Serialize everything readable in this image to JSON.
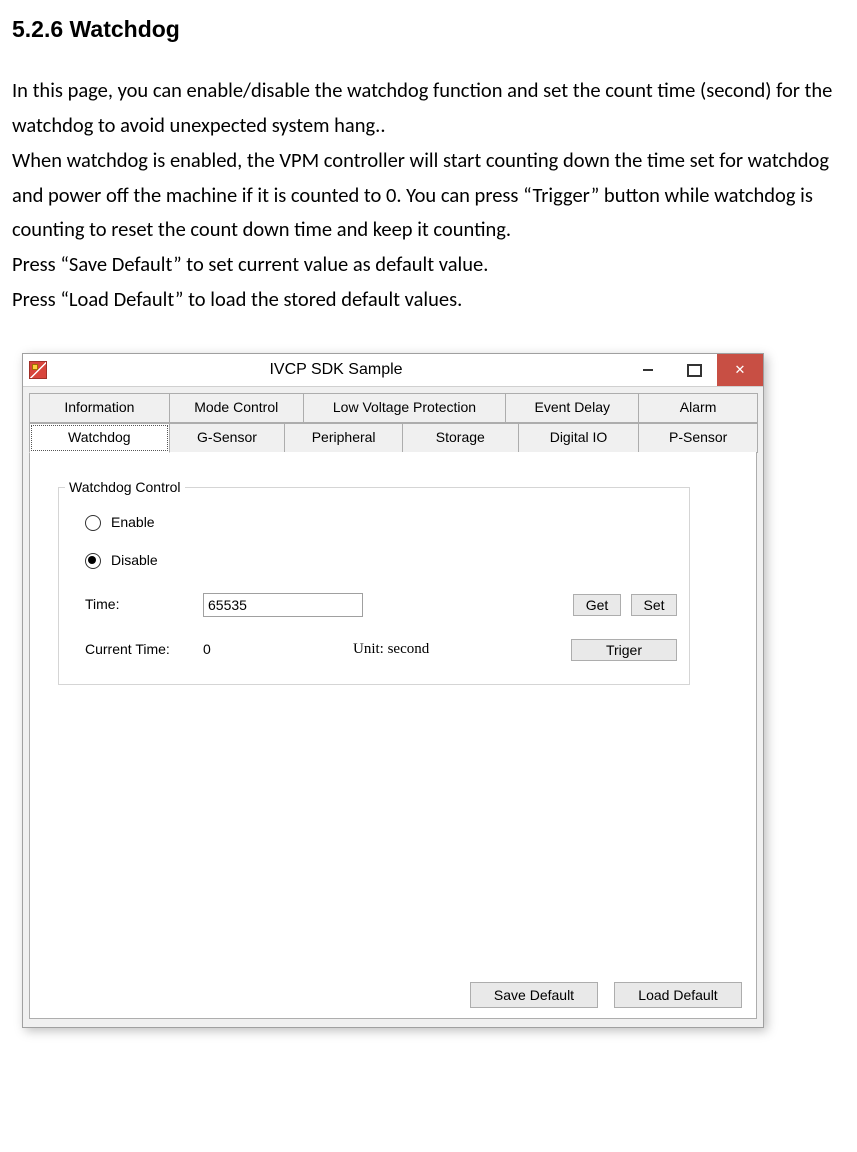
{
  "doc": {
    "heading": "5.2.6 Watchdog",
    "p1": "In this page, you can enable/disable the watchdog function and set the count time (second) for the watchdog to avoid unexpected system hang..",
    "p2": "When watchdog is enabled, the VPM controller will start counting down the time set for watchdog and power off the machine if it is counted to 0. You can press “Trigger” button while watchdog is counting to reset the count down time and keep it counting.",
    "p3": "Press “Save Default” to set current value as default value.",
    "p4": "Press “Load Default” to load the stored default values."
  },
  "window": {
    "title": "IVCP SDK Sample",
    "tabs_row1": [
      "Information",
      "Mode Control",
      "Low Voltage Protection",
      "Event Delay",
      "Alarm"
    ],
    "tabs_row2": [
      "Watchdog",
      "G-Sensor",
      "Peripheral",
      "Storage",
      "Digital IO",
      "P-Sensor"
    ],
    "group_title": "Watchdog Control",
    "radio_enable": "Enable",
    "radio_disable": "Disable",
    "time_label": "Time:",
    "time_value": "65535",
    "get_btn": "Get",
    "set_btn": "Set",
    "curr_label": "Current Time:",
    "curr_value": "0",
    "unit_label": "Unit: second",
    "trigger_btn": "Triger",
    "save_default": "Save Default",
    "load_default": "Load Default"
  }
}
